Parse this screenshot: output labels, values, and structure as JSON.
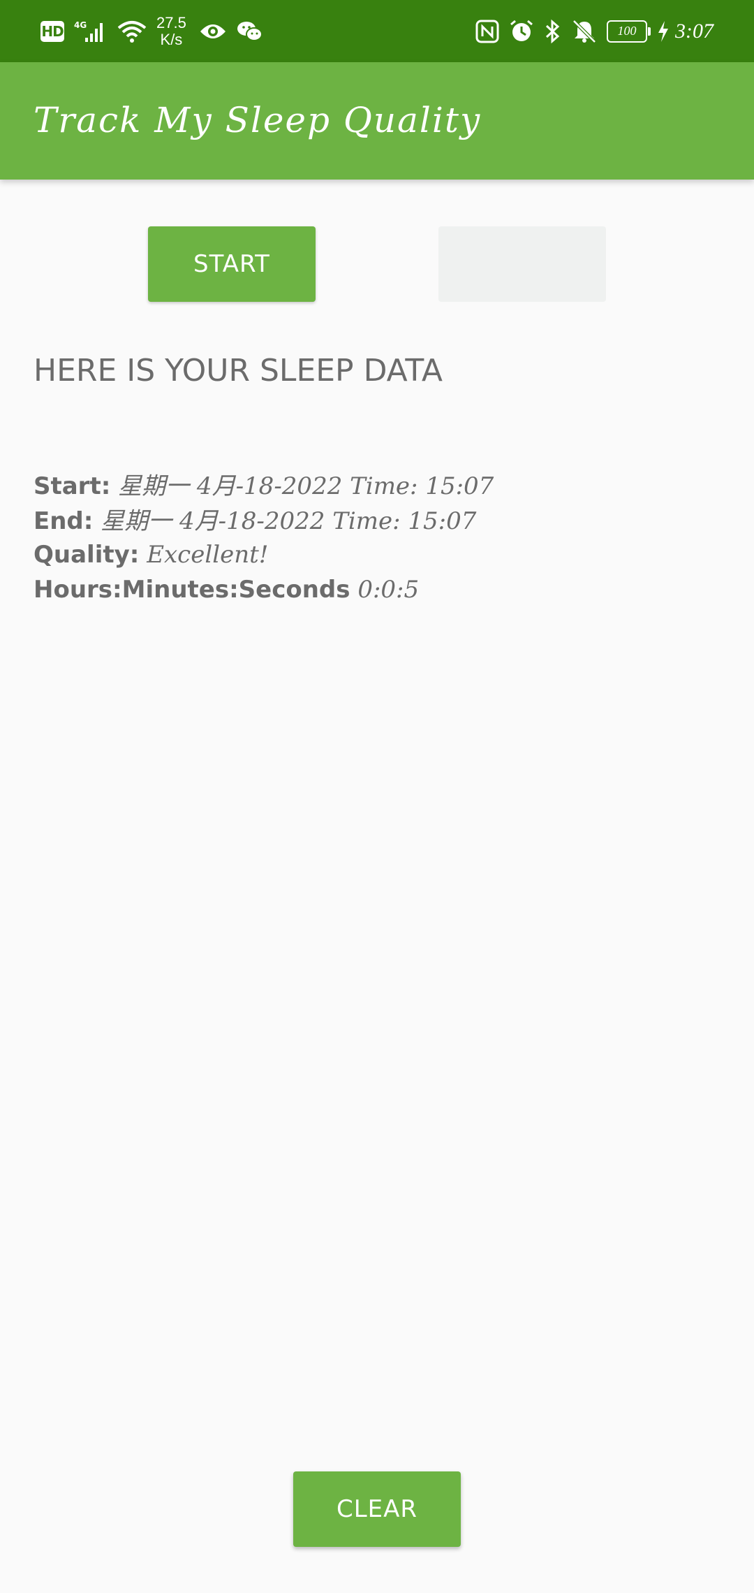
{
  "status_bar": {
    "hd_badge": "HD",
    "network_type": "4G",
    "net_speed_value": "27.5",
    "net_speed_unit": "K/s",
    "battery_level": "100",
    "time": "3:07",
    "icons_left": [
      "hd-icon",
      "signal-icon",
      "wifi-icon",
      "eye-icon",
      "wechat-icon"
    ],
    "icons_right": [
      "nfc-icon",
      "alarm-icon",
      "bluetooth-icon",
      "bell-off-icon",
      "battery-icon",
      "charging-icon"
    ]
  },
  "app_bar": {
    "title": "Track My Sleep Quality"
  },
  "buttons": {
    "start_label": "START",
    "stop_label": "",
    "clear_label": "CLEAR"
  },
  "sleep_data": {
    "heading": "HERE IS YOUR SLEEP DATA",
    "start_label": "Start:",
    "start_value": "星期一 4月-18-2022 Time: 15:07",
    "end_label": "End:",
    "end_value": "星期一 4月-18-2022 Time: 15:07",
    "quality_label": "Quality:",
    "quality_value": "Excellent!",
    "duration_label": "Hours:Minutes:Seconds",
    "duration_value": "0:0:5"
  },
  "colors": {
    "status_bar": "#38810f",
    "app_bar": "#6db343",
    "button_primary": "#6db343",
    "button_disabled": "#eff1f0",
    "text_secondary": "#6b6b6b",
    "background": "#fafafa"
  }
}
